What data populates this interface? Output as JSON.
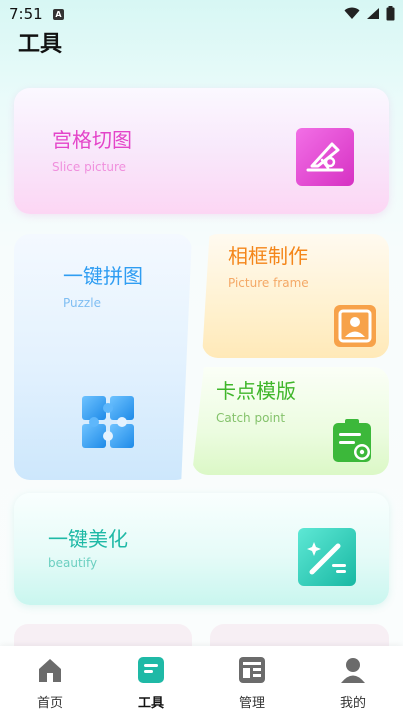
{
  "status_bar": {
    "time": "7:51",
    "notification_glyph": "A"
  },
  "page": {
    "title": "工具"
  },
  "cards": {
    "slice": {
      "title": "宫格切图",
      "subtitle": "Slice picture",
      "icon": "slice-scissors-icon"
    },
    "puzzle": {
      "title": "一键拼图",
      "subtitle": "Puzzle",
      "icon": "puzzle-icon"
    },
    "frame": {
      "title": "相框制作",
      "subtitle": "Picture frame",
      "icon": "portrait-frame-icon"
    },
    "catch": {
      "title": "卡点模版",
      "subtitle": "Catch point",
      "icon": "clipboard-gear-icon"
    },
    "beautify": {
      "title": "一键美化",
      "subtitle": "beautify",
      "icon": "magic-wand-icon"
    }
  },
  "nav": {
    "items": [
      {
        "label": "首页",
        "icon": "home-icon",
        "active": false
      },
      {
        "label": "工具",
        "icon": "tools-icon",
        "active": true
      },
      {
        "label": "管理",
        "icon": "manage-icon",
        "active": false
      },
      {
        "label": "我的",
        "icon": "profile-icon",
        "active": false
      }
    ]
  },
  "colors": {
    "slice_accent": "#e444c9",
    "puzzle_accent": "#2f9df2",
    "frame_accent": "#f4861a",
    "catch_accent": "#3fb62a",
    "beautify_accent": "#1fb9a6"
  }
}
